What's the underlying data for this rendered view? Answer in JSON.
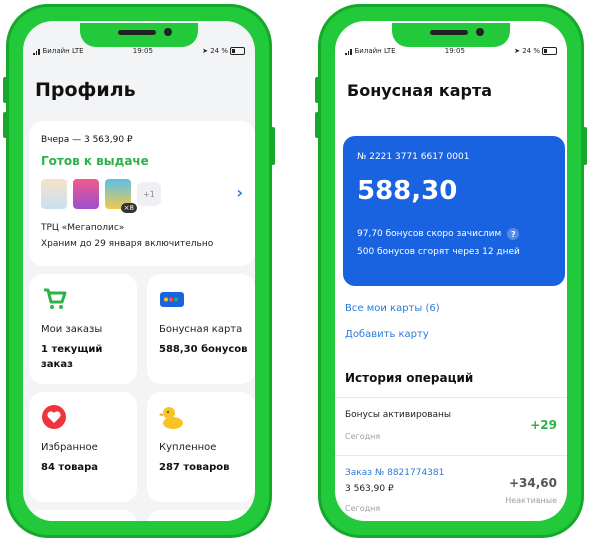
{
  "colors": {
    "frame": "#22c93a",
    "accent_blue": "#1a63e0",
    "link_blue": "#2a7bde",
    "ready_green": "#2bb34a"
  },
  "left": {
    "status": {
      "carrier": "Билайн LTE",
      "time": "19:05",
      "battery": "24 %"
    },
    "title": "Профиль",
    "order": {
      "date": "Вчера — 3 563,90 ₽",
      "status": "Готов к выдаче",
      "extra_count": "+1",
      "qty_badge": "×8",
      "location": "ТРЦ «Мегаполис»",
      "keep": "Храним до 29 января включительно",
      "chevron_icon": "chevron-right-icon"
    },
    "tiles": [
      {
        "icon": "cart-icon",
        "label": "Мои заказы",
        "value": "1 текущий заказ"
      },
      {
        "icon": "bonus-card-icon",
        "label": "Бонусная карта",
        "value": "588,30 бонусов"
      },
      {
        "icon": "heart-icon",
        "label": "Избранное",
        "value": "84 товара"
      },
      {
        "icon": "duck-toy-icon",
        "label": "Купленное",
        "value": "287 товаров"
      }
    ]
  },
  "right": {
    "status": {
      "carrier": "Билайн LTE",
      "time": "19:05",
      "battery": "24 %"
    },
    "title": "Бонусная карта",
    "card": {
      "number": "№ 2221 3771 6617 0001",
      "amount": "588,30",
      "soon": "97,70 бонусов скоро зачислим",
      "help": "?",
      "burn": "500 бонусов сгорят через 12 дней"
    },
    "links": {
      "all_cards": "Все мои карты (6)",
      "add_card": "Добавить карту"
    },
    "history": {
      "title": "История операций",
      "ops": [
        {
          "name": "Бонусы активированы",
          "date": "Сегодня",
          "amount": "+29"
        },
        {
          "name": "Заказ № 8821774381",
          "sum": "3 563,90 ₽",
          "date": "Сегодня",
          "amount": "+34,60",
          "state": "Неактивные"
        }
      ]
    }
  }
}
